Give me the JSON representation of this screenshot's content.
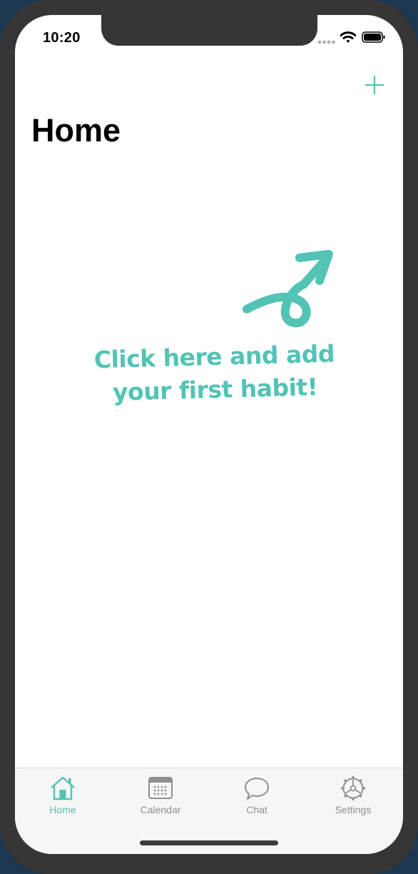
{
  "status_bar": {
    "time": "10:20"
  },
  "nav": {
    "title": "Home",
    "add_icon": "plus-icon"
  },
  "empty_state": {
    "line1": "Click here and add",
    "line2": "your first habit!",
    "arrow_icon": "curly-arrow-icon"
  },
  "tab_bar": {
    "items": [
      {
        "label": "Home",
        "icon": "house-icon",
        "active": true
      },
      {
        "label": "Calendar",
        "icon": "calendar-icon",
        "active": false
      },
      {
        "label": "Chat",
        "icon": "speech-bubble-icon",
        "active": false
      },
      {
        "label": "Settings",
        "icon": "gear-icon",
        "active": false
      }
    ]
  },
  "colors": {
    "accent": "#52c3b5",
    "inactive": "#8e8e93",
    "frame": "#363636"
  }
}
